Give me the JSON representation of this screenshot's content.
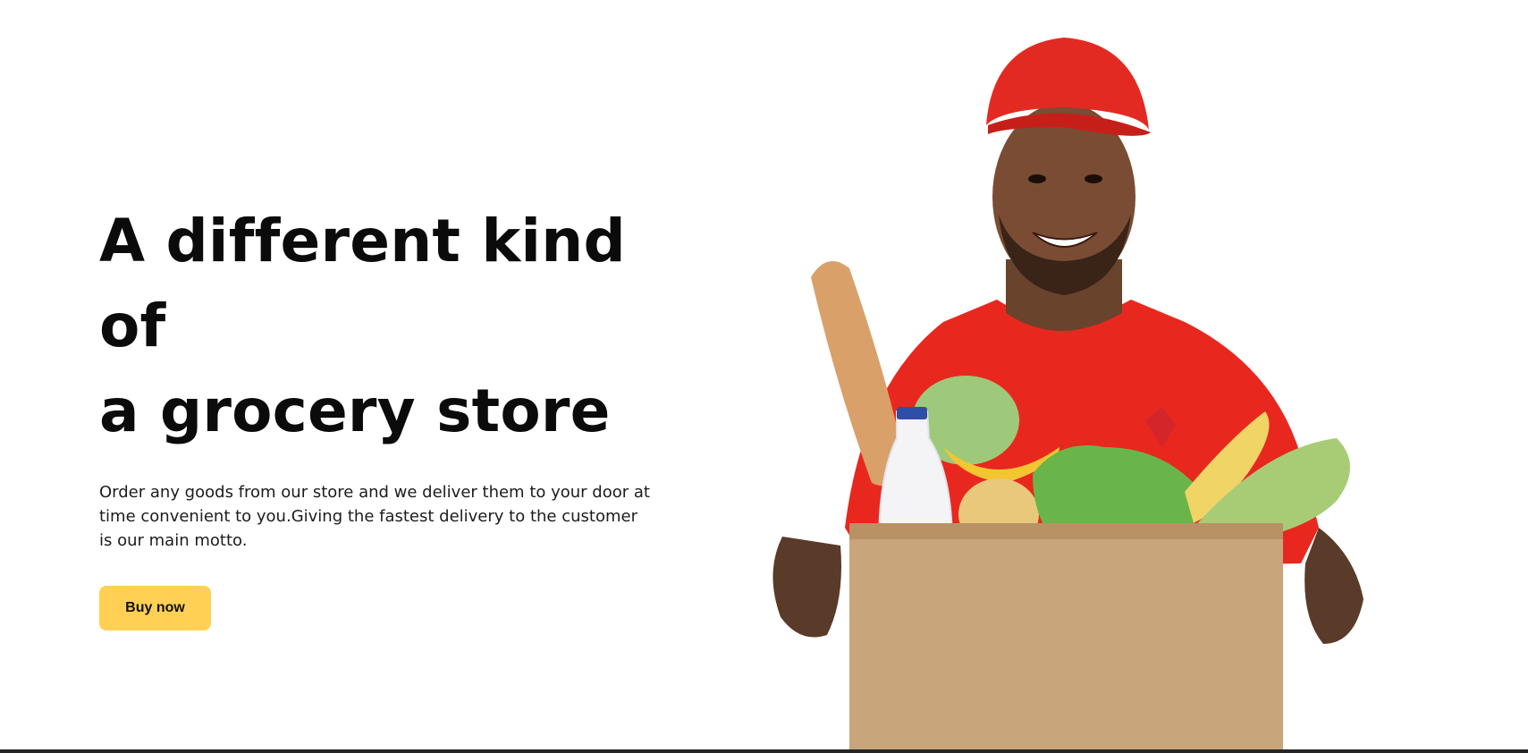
{
  "hero": {
    "title_line1": "A different kind of",
    "title_line2": "a grocery store",
    "description": "Order any goods from our store and we deliver them to your door at time convenient to you.Giving the fastest delivery to the customer is our main motto.",
    "cta_label": "Buy now"
  },
  "image": {
    "subject": "delivery-man-with-grocery-box"
  },
  "colors": {
    "accent": "#ffd054",
    "shirt": "#e8281e",
    "text": "#0b0b0b"
  }
}
